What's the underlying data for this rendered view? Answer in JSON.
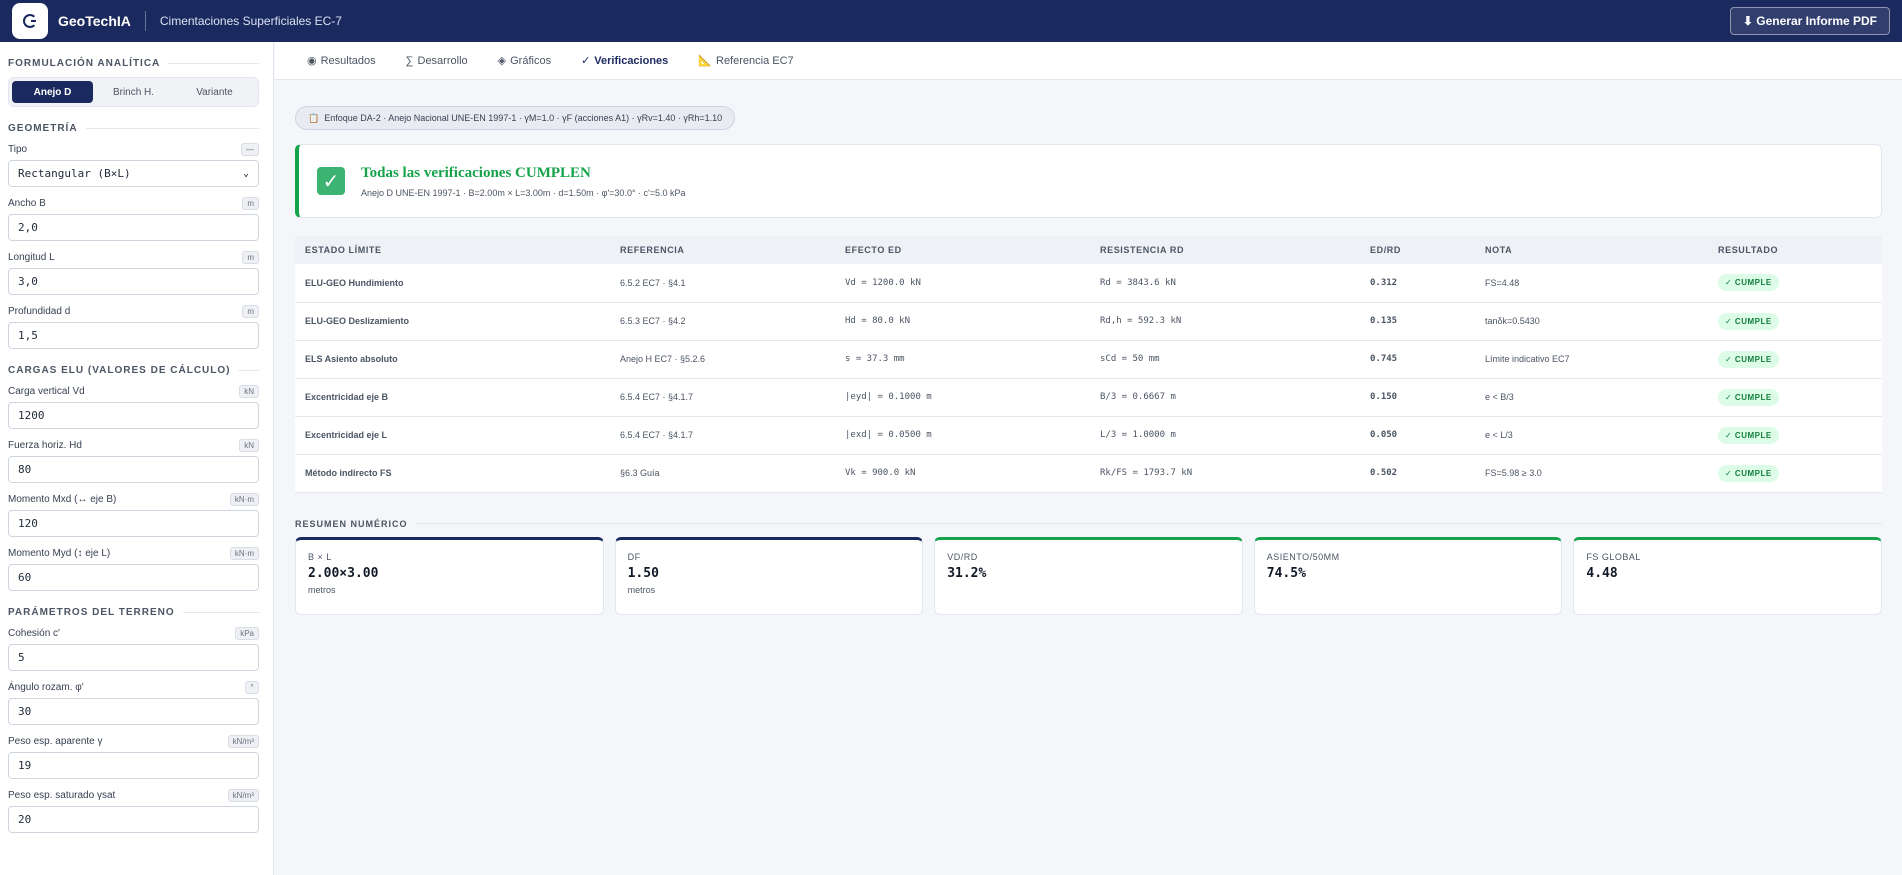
{
  "header": {
    "app_name": "GeoTechIA",
    "subtitle": "Cimentaciones Superficiales EC-7",
    "pdf_button": "⬇ Generar Informe PDF"
  },
  "sidebar": {
    "formulacion": {
      "title": "FORMULACIÓN ANALÍTICA",
      "options": [
        "Anejo D",
        "Brinch H.",
        "Variante"
      ],
      "selected": "Anejo D"
    },
    "geometria": {
      "title": "GEOMETRÍA",
      "tipo_label": "Tipo",
      "tipo_unit": "—",
      "tipo_value": "Rectangular (B×L)",
      "ancho_label": "Ancho B",
      "ancho_unit": "m",
      "ancho_value": "2,0",
      "longitud_label": "Longitud L",
      "longitud_unit": "m",
      "longitud_value": "3,0",
      "profundidad_label": "Profundidad d",
      "profundidad_unit": "m",
      "profundidad_value": "1,5"
    },
    "cargas": {
      "title": "CARGAS ELU (VALORES DE CÁLCULO)",
      "vd_label": "Carga vertical Vd",
      "vd_unit": "kN",
      "vd_value": "1200",
      "hd_label": "Fuerza horiz. Hd",
      "hd_unit": "kN",
      "hd_value": "80",
      "mxd_label": "Momento Mxd (↔ eje B)",
      "mxd_unit": "kN·m",
      "mxd_value": "120",
      "myd_label": "Momento Myd (↕ eje L)",
      "myd_unit": "kN·m",
      "myd_value": "60"
    },
    "terreno": {
      "title": "PARÁMETROS DEL TERRENO",
      "cohesion_label": "Cohesión c'",
      "cohesion_unit": "kPa",
      "cohesion_value": "5",
      "angulo_label": "Ángulo rozam. φ'",
      "angulo_unit": "°",
      "angulo_value": "30",
      "peso_ap_label": "Peso esp. aparente γ",
      "peso_ap_unit": "kN/m³",
      "peso_ap_value": "19",
      "peso_sat_label": "Peso esp. saturado γsat",
      "peso_sat_unit": "kN/m³",
      "peso_sat_value": "20"
    }
  },
  "tabs": [
    {
      "icon": "◉",
      "label": "Resultados"
    },
    {
      "icon": "∑",
      "label": "Desarrollo"
    },
    {
      "icon": "◈",
      "label": "Gráficos"
    },
    {
      "icon": "✓",
      "label": "Verificaciones"
    },
    {
      "icon": "📐",
      "label": "Referencia EC7"
    }
  ],
  "active_tab": "Verificaciones",
  "enfoque_pill": "Enfoque DA-2 · Anejo Nacional UNE-EN 1997-1 · γM=1.0 · γF (acciones A1) · γRv=1.40 · γRh=1.10",
  "banner": {
    "title": "Todas las verificaciones CUMPLEN",
    "subtitle": "Anejo D UNE-EN 1997-1 · B=2.00m × L=3.00m · d=1.50m · φ'=30.0° · c'=5.0 kPa"
  },
  "table": {
    "headers": [
      "ESTADO LÍMITE",
      "REFERENCIA",
      "EFECTO ED",
      "RESISTENCIA RD",
      "ED/RD",
      "NOTA",
      "RESULTADO"
    ],
    "rows": [
      {
        "estado": "ELU-GEO Hundimiento",
        "ref": "6.5.2 EC7 · §4.1",
        "efecto": "Vd = 1200.0 kN",
        "resist": "Rd = 3843.6 kN",
        "ratio": "0.312",
        "nota": "FS=4.48",
        "resultado": "✓ CUMPLE"
      },
      {
        "estado": "ELU-GEO Deslizamiento",
        "ref": "6.5.3 EC7 · §4.2",
        "efecto": "Hd = 80.0 kN",
        "resist": "Rd,h = 592.3 kN",
        "ratio": "0.135",
        "nota": "tanδk=0.5430",
        "resultado": "✓ CUMPLE"
      },
      {
        "estado": "ELS Asiento absoluto",
        "ref": "Anejo H EC7 · §5.2.6",
        "efecto": "s = 37.3 mm",
        "resist": "sCd = 50 mm",
        "ratio": "0.745",
        "nota": "Límite indicativo EC7",
        "resultado": "✓ CUMPLE"
      },
      {
        "estado": "Excentricidad eje B",
        "ref": "6.5.4 EC7 · §4.1.7",
        "efecto": "|eyd| = 0.1000 m",
        "resist": "B/3 = 0.6667 m",
        "ratio": "0.150",
        "nota": "e < B/3",
        "resultado": "✓ CUMPLE"
      },
      {
        "estado": "Excentricidad eje L",
        "ref": "6.5.4 EC7 · §4.1.7",
        "efecto": "|exd| = 0.0500 m",
        "resist": "L/3 = 1.0000 m",
        "ratio": "0.050",
        "nota": "e < L/3",
        "resultado": "✓ CUMPLE"
      },
      {
        "estado": "Método indirecto FS",
        "ref": "§6.3 Guía",
        "efecto": "Vk = 900.0 kN",
        "resist": "Rk/FS = 1793.7 kN",
        "ratio": "0.502",
        "nota": "FS=5.98 ≥ 3.0",
        "resultado": "✓ CUMPLE"
      }
    ]
  },
  "resumen": {
    "title": "RESUMEN NUMÉRICO",
    "cards": [
      {
        "label": "B × L",
        "value": "2.00×3.00",
        "unit": "metros"
      },
      {
        "label": "Df",
        "value": "1.50",
        "unit": "metros"
      },
      {
        "label": "Vd/Rd",
        "value": "31.2%",
        "unit": ""
      },
      {
        "label": "Asiento/50mm",
        "value": "74.5%",
        "unit": ""
      },
      {
        "label": "FS Global",
        "value": "4.48",
        "unit": ""
      }
    ]
  },
  "colors": {
    "brand": "#1b2a5e",
    "success": "#16a34a"
  }
}
